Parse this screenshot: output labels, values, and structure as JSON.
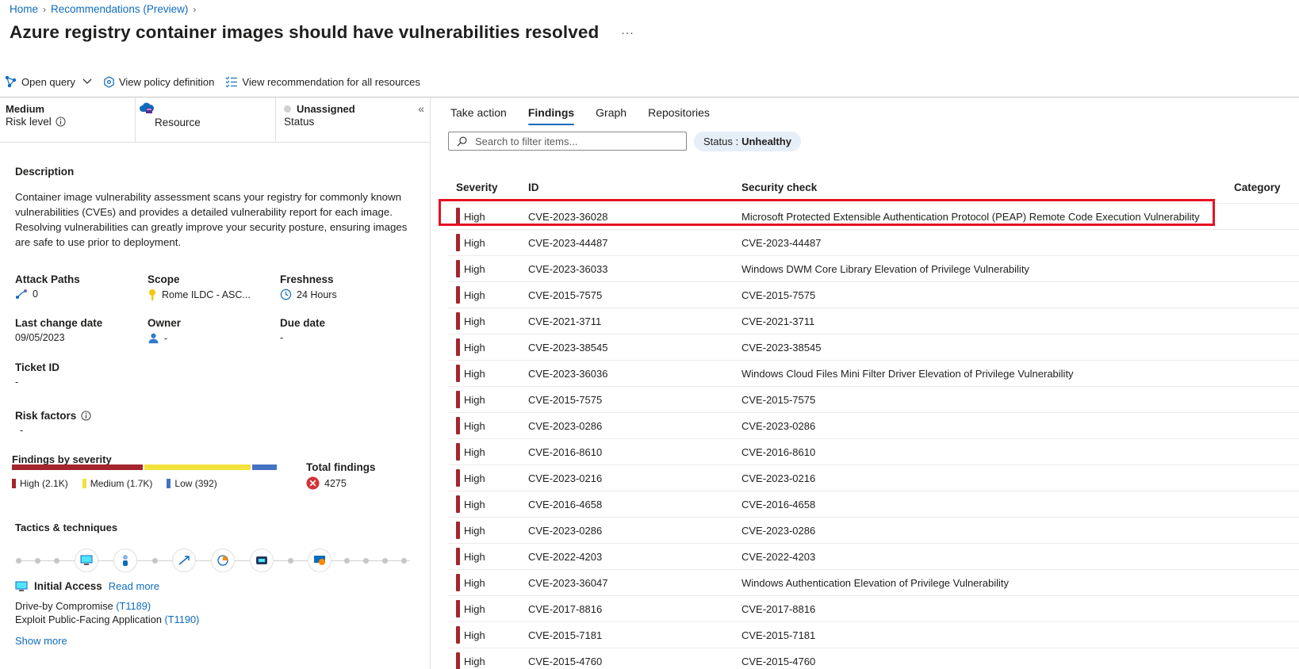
{
  "breadcrumb": {
    "home": "Home",
    "recommendations": "Recommendations (Preview)"
  },
  "title": "Azure registry container images should have vulnerabilities resolved",
  "more_label": "...",
  "toolbar": {
    "open_query": "Open query",
    "view_policy": "View policy definition",
    "view_all": "View recommendation for all resources"
  },
  "summary": {
    "risk_value": "Medium",
    "risk_label": "Risk level",
    "resource_label": "Resource",
    "status_value": "Unassigned",
    "status_label": "Status"
  },
  "description": {
    "heading": "Description",
    "text": "Container image vulnerability assessment scans your registry for commonly known vulnerabilities (CVEs) and provides a detailed vulnerability report for each image. Resolving vulnerabilities can greatly improve your security posture, ensuring images are safe to use prior to deployment."
  },
  "fields": {
    "attack_paths_label": "Attack Paths",
    "attack_paths_value": "0",
    "scope_label": "Scope",
    "scope_value": "Rome ILDC - ASC...",
    "freshness_label": "Freshness",
    "freshness_value": "24 Hours",
    "last_change_label": "Last change date",
    "last_change_value": "09/05/2023",
    "owner_label": "Owner",
    "owner_value": "-",
    "due_label": "Due date",
    "due_value": "-",
    "ticket_label": "Ticket ID",
    "ticket_value": "-",
    "risk_factors_label": "Risk factors",
    "risk_factors_value": "-"
  },
  "findings_by_severity": {
    "label": "Findings by severity",
    "high": "High (2.1K)",
    "medium": "Medium (1.7K)",
    "low": "Low (392)",
    "high_count": 2100,
    "medium_count": 1700,
    "low_count": 392,
    "colors": {
      "high": "#a4262c",
      "medium": "#f2e23c",
      "low": "#4472c4"
    }
  },
  "total_findings": {
    "label": "Total findings",
    "value": "4275"
  },
  "tactics": {
    "heading": "Tactics & techniques",
    "initial_access": "Initial Access",
    "read_more": "Read more",
    "technique1": "Drive-by Compromise",
    "technique1_id": "(T1189)",
    "technique2": "Exploit Public-Facing Application",
    "technique2_id": "(T1190)",
    "show_more": "Show more"
  },
  "tabs": [
    "Take action",
    "Findings",
    "Graph",
    "Repositories"
  ],
  "search": {
    "placeholder": "Search to filter items..."
  },
  "status_filter": {
    "key": "Status :",
    "value": "Unhealthy"
  },
  "table": {
    "headers": {
      "severity": "Severity",
      "id": "ID",
      "check": "Security check",
      "category": "Category"
    },
    "rows": [
      {
        "severity": "High",
        "id": "CVE-2023-36028",
        "check": "Microsoft Protected Extensible Authentication Protocol (PEAP) Remote Code Execution Vulnerability"
      },
      {
        "severity": "High",
        "id": "CVE-2023-44487",
        "check": "CVE-2023-44487"
      },
      {
        "severity": "High",
        "id": "CVE-2023-36033",
        "check": "Windows DWM Core Library Elevation of Privilege Vulnerability"
      },
      {
        "severity": "High",
        "id": "CVE-2015-7575",
        "check": "CVE-2015-7575"
      },
      {
        "severity": "High",
        "id": "CVE-2021-3711",
        "check": "CVE-2021-3711"
      },
      {
        "severity": "High",
        "id": "CVE-2023-38545",
        "check": "CVE-2023-38545"
      },
      {
        "severity": "High",
        "id": "CVE-2023-36036",
        "check": "Windows Cloud Files Mini Filter Driver Elevation of Privilege Vulnerability"
      },
      {
        "severity": "High",
        "id": "CVE-2015-7575",
        "check": "CVE-2015-7575"
      },
      {
        "severity": "High",
        "id": "CVE-2023-0286",
        "check": "CVE-2023-0286"
      },
      {
        "severity": "High",
        "id": "CVE-2016-8610",
        "check": "CVE-2016-8610"
      },
      {
        "severity": "High",
        "id": "CVE-2023-0216",
        "check": "CVE-2023-0216"
      },
      {
        "severity": "High",
        "id": "CVE-2016-4658",
        "check": "CVE-2016-4658"
      },
      {
        "severity": "High",
        "id": "CVE-2023-0286",
        "check": "CVE-2023-0286"
      },
      {
        "severity": "High",
        "id": "CVE-2022-4203",
        "check": "CVE-2022-4203"
      },
      {
        "severity": "High",
        "id": "CVE-2023-36047",
        "check": "Windows Authentication Elevation of Privilege Vulnerability"
      },
      {
        "severity": "High",
        "id": "CVE-2017-8816",
        "check": "CVE-2017-8816"
      },
      {
        "severity": "High",
        "id": "CVE-2015-7181",
        "check": "CVE-2015-7181"
      },
      {
        "severity": "High",
        "id": "CVE-2015-4760",
        "check": "CVE-2015-4760"
      }
    ]
  }
}
